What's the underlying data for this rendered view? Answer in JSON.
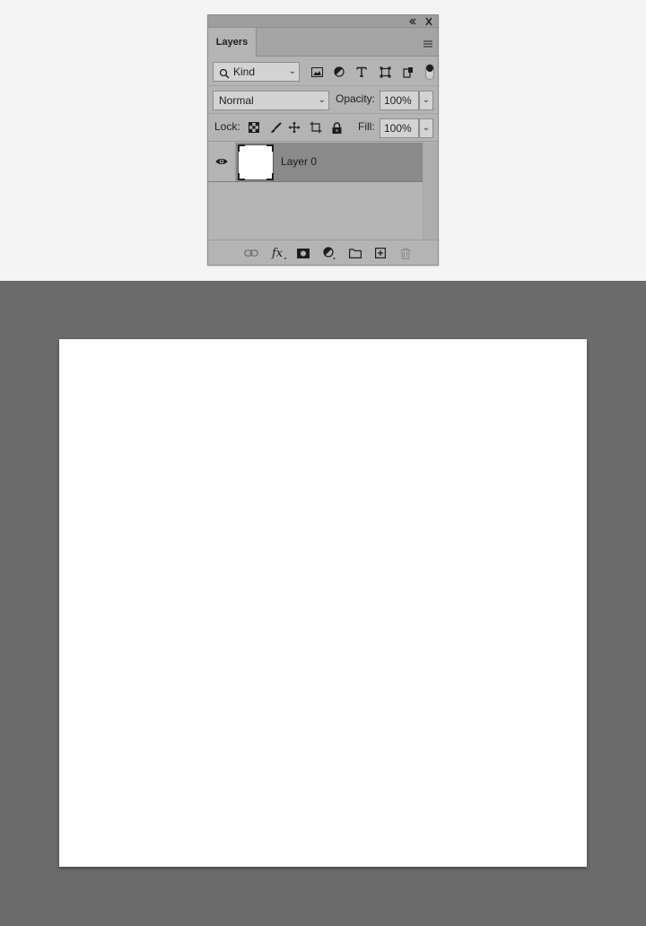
{
  "panel": {
    "title_tab": "Layers",
    "collapse_icon": "double-chevron-left-icon",
    "close_icon": "close-icon",
    "menu_icon": "hamburger-menu-icon"
  },
  "filter": {
    "kind_label": "Kind",
    "search_icon": "search-icon",
    "filter_icons": [
      "image-filter-icon",
      "adjustment-filter-icon",
      "type-filter-icon",
      "shape-filter-icon",
      "smart-object-filter-icon"
    ]
  },
  "blend": {
    "mode": "Normal",
    "opacity_label": "Opacity:",
    "opacity_value": "100%"
  },
  "lock": {
    "lock_label": "Lock:",
    "fill_label": "Fill:",
    "fill_value": "100%",
    "lock_icons": [
      "lock-transparent-pixels-icon",
      "lock-image-pixels-icon",
      "lock-position-icon",
      "lock-artboard-icon",
      "lock-all-icon"
    ]
  },
  "layers": [
    {
      "name": "Layer 0",
      "visible": true,
      "selected": true
    }
  ],
  "footer_icons": [
    "link-layers-icon",
    "fx-icon",
    "layer-mask-icon",
    "adjustment-layer-icon",
    "folder-icon",
    "new-layer-icon",
    "trash-icon"
  ],
  "colors": {
    "panel_bg": "#b4b4b4",
    "selected_layer": "#8a8a8a",
    "workspace": "#6b6b6b",
    "document": "#ffffff"
  }
}
